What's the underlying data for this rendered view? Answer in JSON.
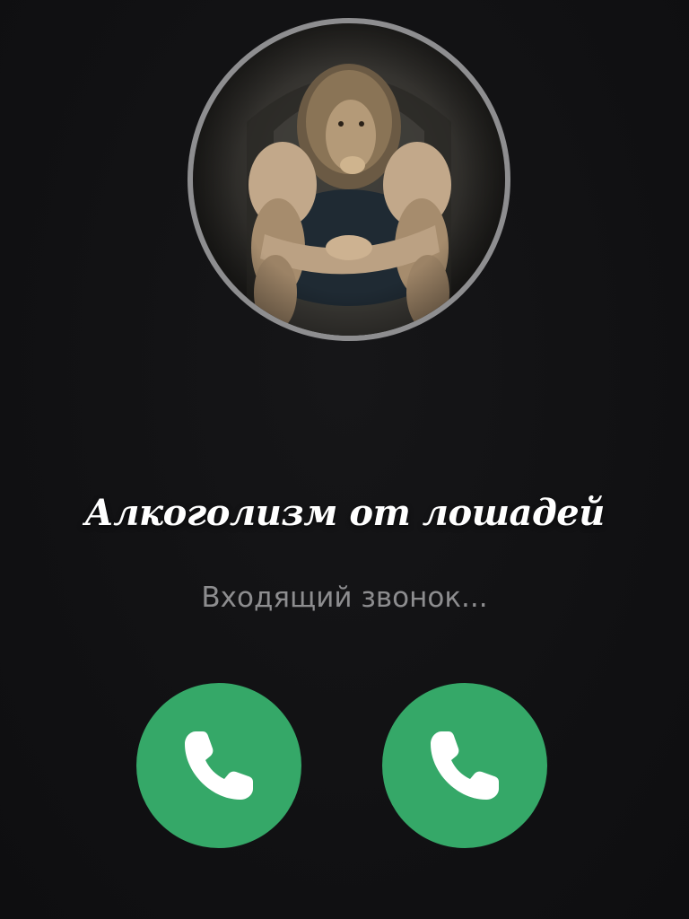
{
  "caller": {
    "name": "Алкоголизм от лошадей",
    "status": "Входящий звонок...",
    "avatar_icon": "lion-bodybuilder-avatar"
  },
  "actions": {
    "left_button_icon": "phone-icon",
    "right_button_icon": "phone-icon",
    "button_color": "#35a868"
  },
  "colors": {
    "background": "#111113",
    "avatar_ring": "#8e8e90",
    "status_text": "#8d8d8f"
  }
}
